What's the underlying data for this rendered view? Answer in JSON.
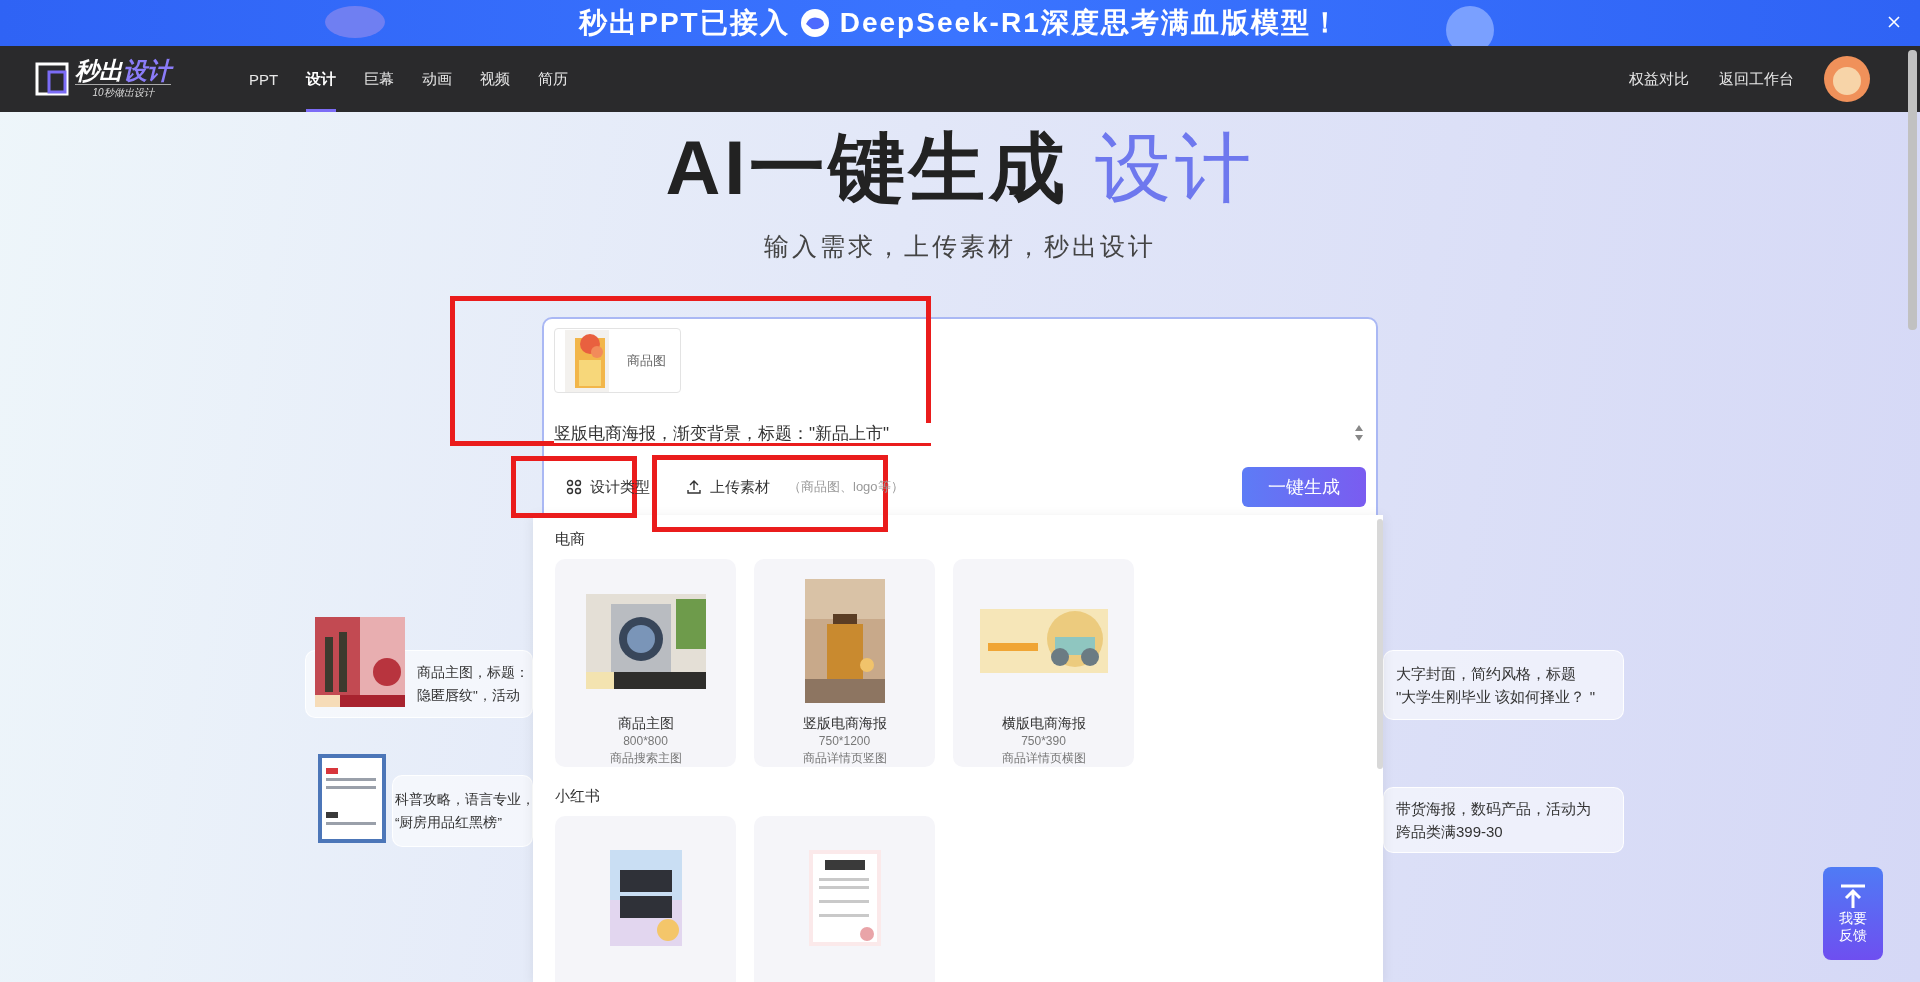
{
  "banner": {
    "text_before": "秒出PPT已接入",
    "text_after": "DeepSeek-R1深度思考满血版模型！"
  },
  "nav": {
    "logo": {
      "title_main": "秒出",
      "title_accent": "设计",
      "tagline": "10秒做出设计"
    },
    "items": [
      {
        "label": "PPT",
        "selected": false
      },
      {
        "label": "设计",
        "selected": true
      },
      {
        "label": "巨幕",
        "selected": false
      },
      {
        "label": "动画",
        "selected": false
      },
      {
        "label": "视频",
        "selected": false
      },
      {
        "label": "简历",
        "selected": false
      }
    ],
    "right_links": [
      "权益对比",
      "返回工作台"
    ]
  },
  "hero": {
    "title_main": "AI一键生成",
    "title_accent": "设计",
    "subtitle": "输入需求，上传素材，秒出设计"
  },
  "composer": {
    "attachment": {
      "label": "商品图"
    },
    "value": "竖版电商海报，渐变背景，标题：\"新品上市\"",
    "design_type": "设计类型",
    "upload": "上传素材",
    "upload_hint": "（商品图、logo等）",
    "submit": "一键生成"
  },
  "examples_left": [
    {
      "lines": [
        "商品主图，标题：",
        "隐匿唇纹\"，活动"
      ]
    },
    {
      "lines": [
        "科普攻略，语言专业，",
        "“厨房用品红黑榜”"
      ]
    }
  ],
  "examples_right": [
    {
      "lines": [
        "大字封面，简约风格，标题",
        "\"大学生刚毕业 该如何择业？ \""
      ]
    },
    {
      "lines": [
        "带货海报，数码产品，活动为",
        "跨品类满399-30"
      ]
    }
  ],
  "dropdown": {
    "sections": [
      {
        "title": "电商",
        "items": [
          {
            "kind": "template",
            "name": "商品主图",
            "size": "800*800",
            "desc": "商品搜索主图"
          },
          {
            "kind": "template",
            "name": "竖版电商海报",
            "size": "750*1200",
            "desc": "商品详情页竖图"
          },
          {
            "kind": "template",
            "name": "横版电商海报",
            "size": "750*390",
            "desc": "商品详情页横图"
          }
        ]
      },
      {
        "title": "小红书"
      }
    ]
  },
  "feedback": {
    "lines": [
      "我要",
      "反馈"
    ]
  }
}
